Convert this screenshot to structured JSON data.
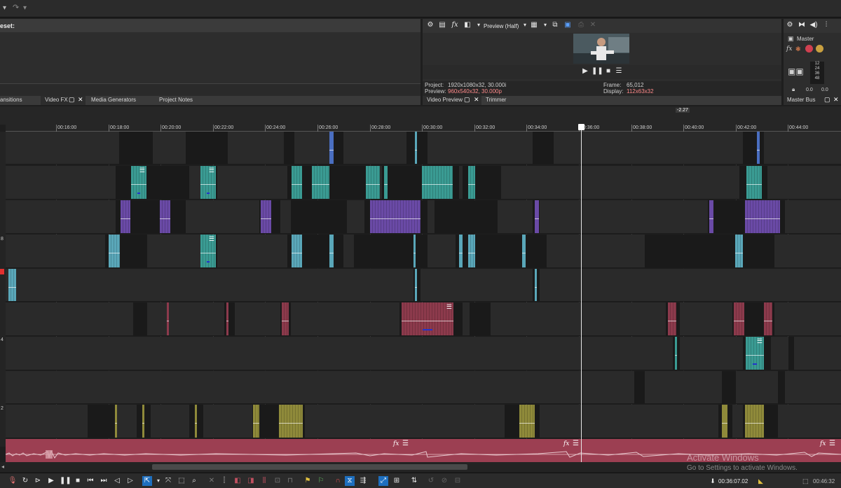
{
  "top_panel": {
    "preset_label": "eset:",
    "tabs": [
      "ansitions",
      "Video FX",
      "Media Generators",
      "Project Notes"
    ]
  },
  "preview": {
    "mode_label": "Preview (Half)",
    "project_label": "Project:",
    "project_value": "1920x1080x32, 30.000i",
    "preview_label": "Preview:",
    "preview_value": "960x540x32, 30.000p",
    "frame_label": "Frame:",
    "frame_value": "65,012",
    "display_label": "Display:",
    "display_value": "112x63x32",
    "tabs": [
      "Video Preview",
      "Trimmer"
    ]
  },
  "master": {
    "label": "Master",
    "meter_values": [
      "12",
      "24",
      "36",
      "48"
    ],
    "left_level": "0.0",
    "right_level": "0.0",
    "tab": "Master Bus"
  },
  "timeline": {
    "marker_label": "-2.27",
    "ruler": [
      "00:16:00",
      "00:18:00",
      "00:20:00",
      "00:22:00",
      "00:24:00",
      "00:26:00",
      "00:28:00",
      "00:30:00",
      "00:32:00",
      "00:34:00",
      "00:36:00",
      "00:38:00",
      "00:40:00",
      "00:42:00",
      "00:44:00"
    ],
    "track_numbers": [
      "8",
      "4",
      "2"
    ],
    "colors": {
      "teal": "#3a9b93",
      "purple": "#6a4aa6",
      "lightblue": "#5aa7b9",
      "crimson": "#8c3a4c",
      "olive": "#8f8a3a",
      "audio": "#9c3f52"
    }
  },
  "status": {
    "timecode": "00:36:07.02",
    "end_timecode": "00:46:32"
  },
  "watermark": {
    "title": "Activate Windows",
    "subtitle": "Go to Settings to activate Windows."
  }
}
